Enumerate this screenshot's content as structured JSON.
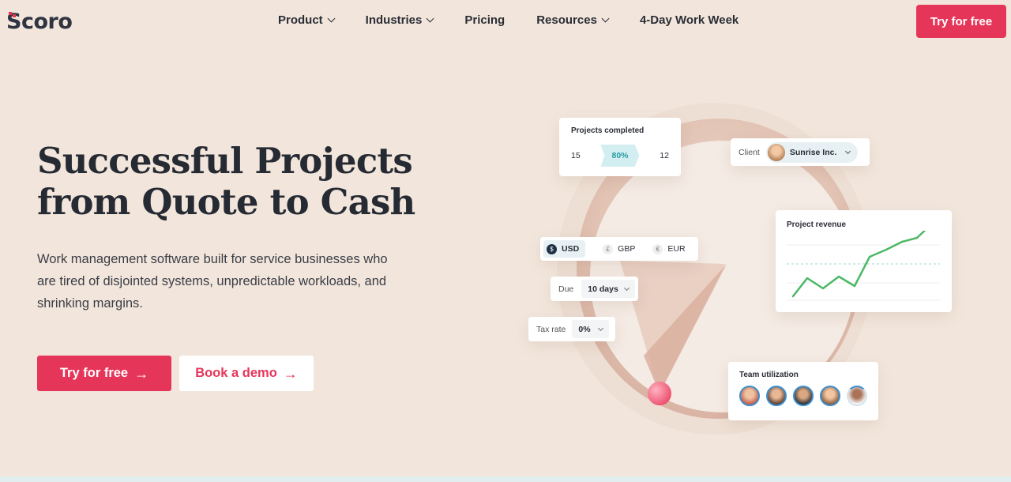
{
  "brand": {
    "logo_text": "Scoro",
    "accent": "#e5365a"
  },
  "nav": {
    "items": [
      {
        "label": "Product",
        "has_dropdown": true
      },
      {
        "label": "Industries",
        "has_dropdown": true
      },
      {
        "label": "Pricing",
        "has_dropdown": false
      },
      {
        "label": "Resources",
        "has_dropdown": true
      },
      {
        "label": "4-Day Work Week",
        "has_dropdown": false
      }
    ],
    "cta_label": "Try for free"
  },
  "hero": {
    "headline_line1": "Successful Projects",
    "headline_line2": "from Quote to Cash",
    "subtext": "Work management software built for service businesses who are tired of disjointed systems, unpredictable workloads, and shrinking margins.",
    "primary_cta": "Try for free",
    "secondary_cta": "Book a demo"
  },
  "widgets": {
    "projects_completed": {
      "title": "Projects completed",
      "left": "15",
      "center": "80%",
      "right": "12"
    },
    "client": {
      "label": "Client",
      "value": "Sunrise Inc."
    },
    "currency": {
      "options": [
        "USD",
        "GBP",
        "EUR"
      ],
      "symbols": [
        "$",
        "£",
        "€"
      ],
      "selected": "USD"
    },
    "due": {
      "label": "Due",
      "value": "10 days"
    },
    "tax_rate": {
      "label": "Tax rate",
      "value": "0%"
    },
    "project_revenue": {
      "title": "Project revenue"
    },
    "team_utilization": {
      "title": "Team utilization",
      "member_count": 5
    }
  }
}
